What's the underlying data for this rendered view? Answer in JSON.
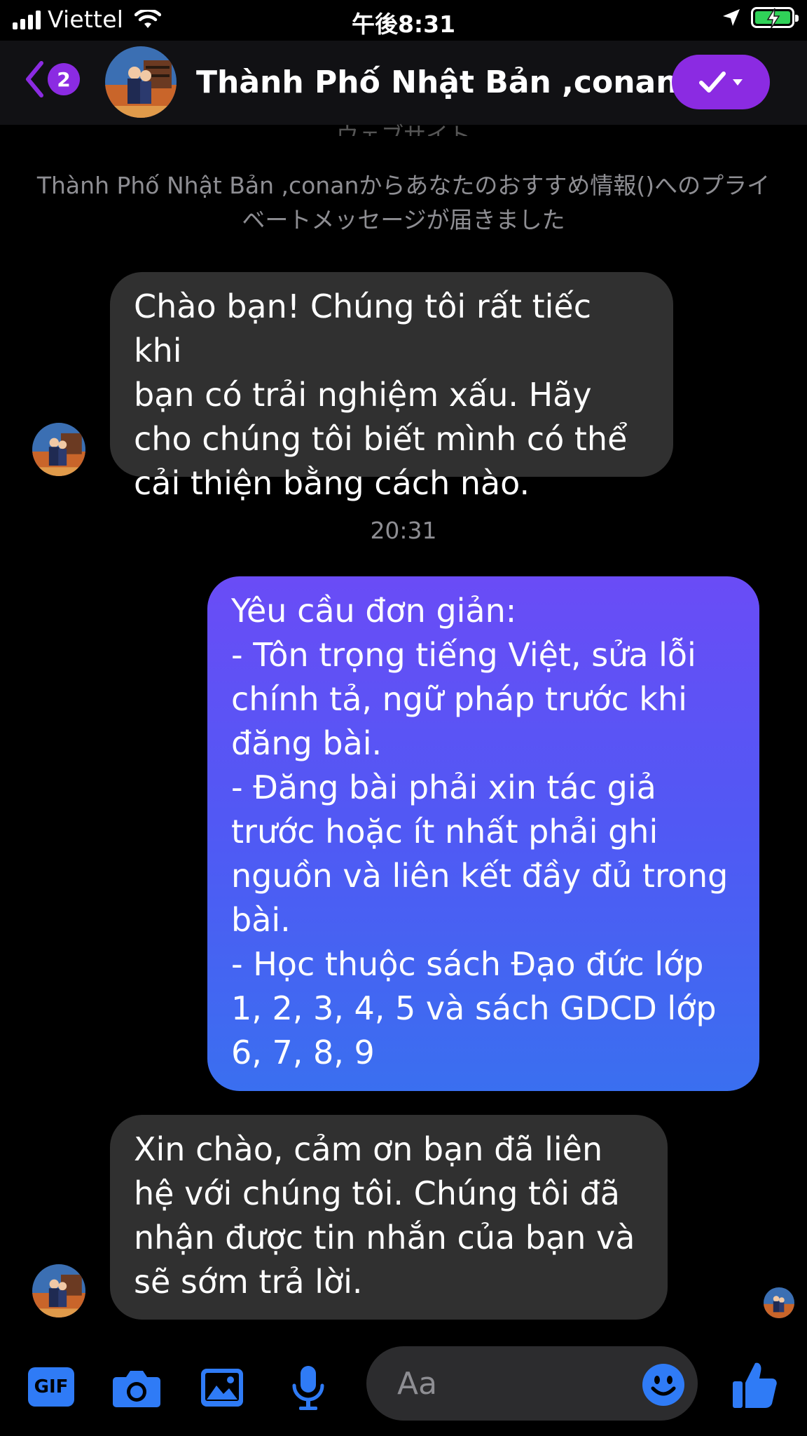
{
  "status_bar": {
    "carrier": "Viettel",
    "time": "午後8:31"
  },
  "header": {
    "back_badge": "2",
    "title": "Thành Phố Nhật Bản ,conan"
  },
  "chat": {
    "cut_text": "ウェブサイト",
    "system_message": "Thành Phố Nhật Bản ,conanからあなたのおすすめ情報()へのプライベートメッセージが届きました",
    "timestamp": "20:31",
    "messages": [
      {
        "direction": "incoming",
        "text": "Chào bạn! Chúng tôi rất tiếc khi\nbạn có trải nghiệm xấu. Hãy\ncho chúng tôi biết mình có thể\ncải thiện bằng cách nào."
      },
      {
        "direction": "outgoing",
        "text": "Yêu cầu đơn giản:\n- Tôn trọng tiếng Việt, sửa lỗi\nchính tả, ngữ pháp trước khi\nđăng bài.\n- Đăng bài phải xin tác giả\ntrước hoặc ít nhất phải ghi\nnguồn và liên kết đầy đủ trong\nbài.\n- Học thuộc sách Đạo đức lớp\n1, 2, 3, 4, 5 và sách GDCD lớp\n6, 7, 8, 9"
      },
      {
        "direction": "incoming",
        "text": "Xin chào, cảm ơn bạn đã liên\nhệ với chúng tôi. Chúng tôi đã\nnhận được tin nhắn của bạn và\nsẽ sớm trả lời."
      }
    ]
  },
  "composer": {
    "gif_label": "GIF",
    "placeholder": "Aa"
  },
  "colors": {
    "accent": "#8b2be2",
    "icon_blue": "#2f7bf6",
    "incoming_bubble": "#303030",
    "outgoing_bubble_top": "#6a4cf6",
    "outgoing_bubble_bottom": "#3a6ff0"
  },
  "icons": [
    "signal-icon",
    "wifi-icon",
    "location-icon",
    "battery-icon",
    "back-chevron-icon",
    "check-icon",
    "camera-icon",
    "photo-icon",
    "mic-icon",
    "emoji-icon",
    "like-icon"
  ]
}
